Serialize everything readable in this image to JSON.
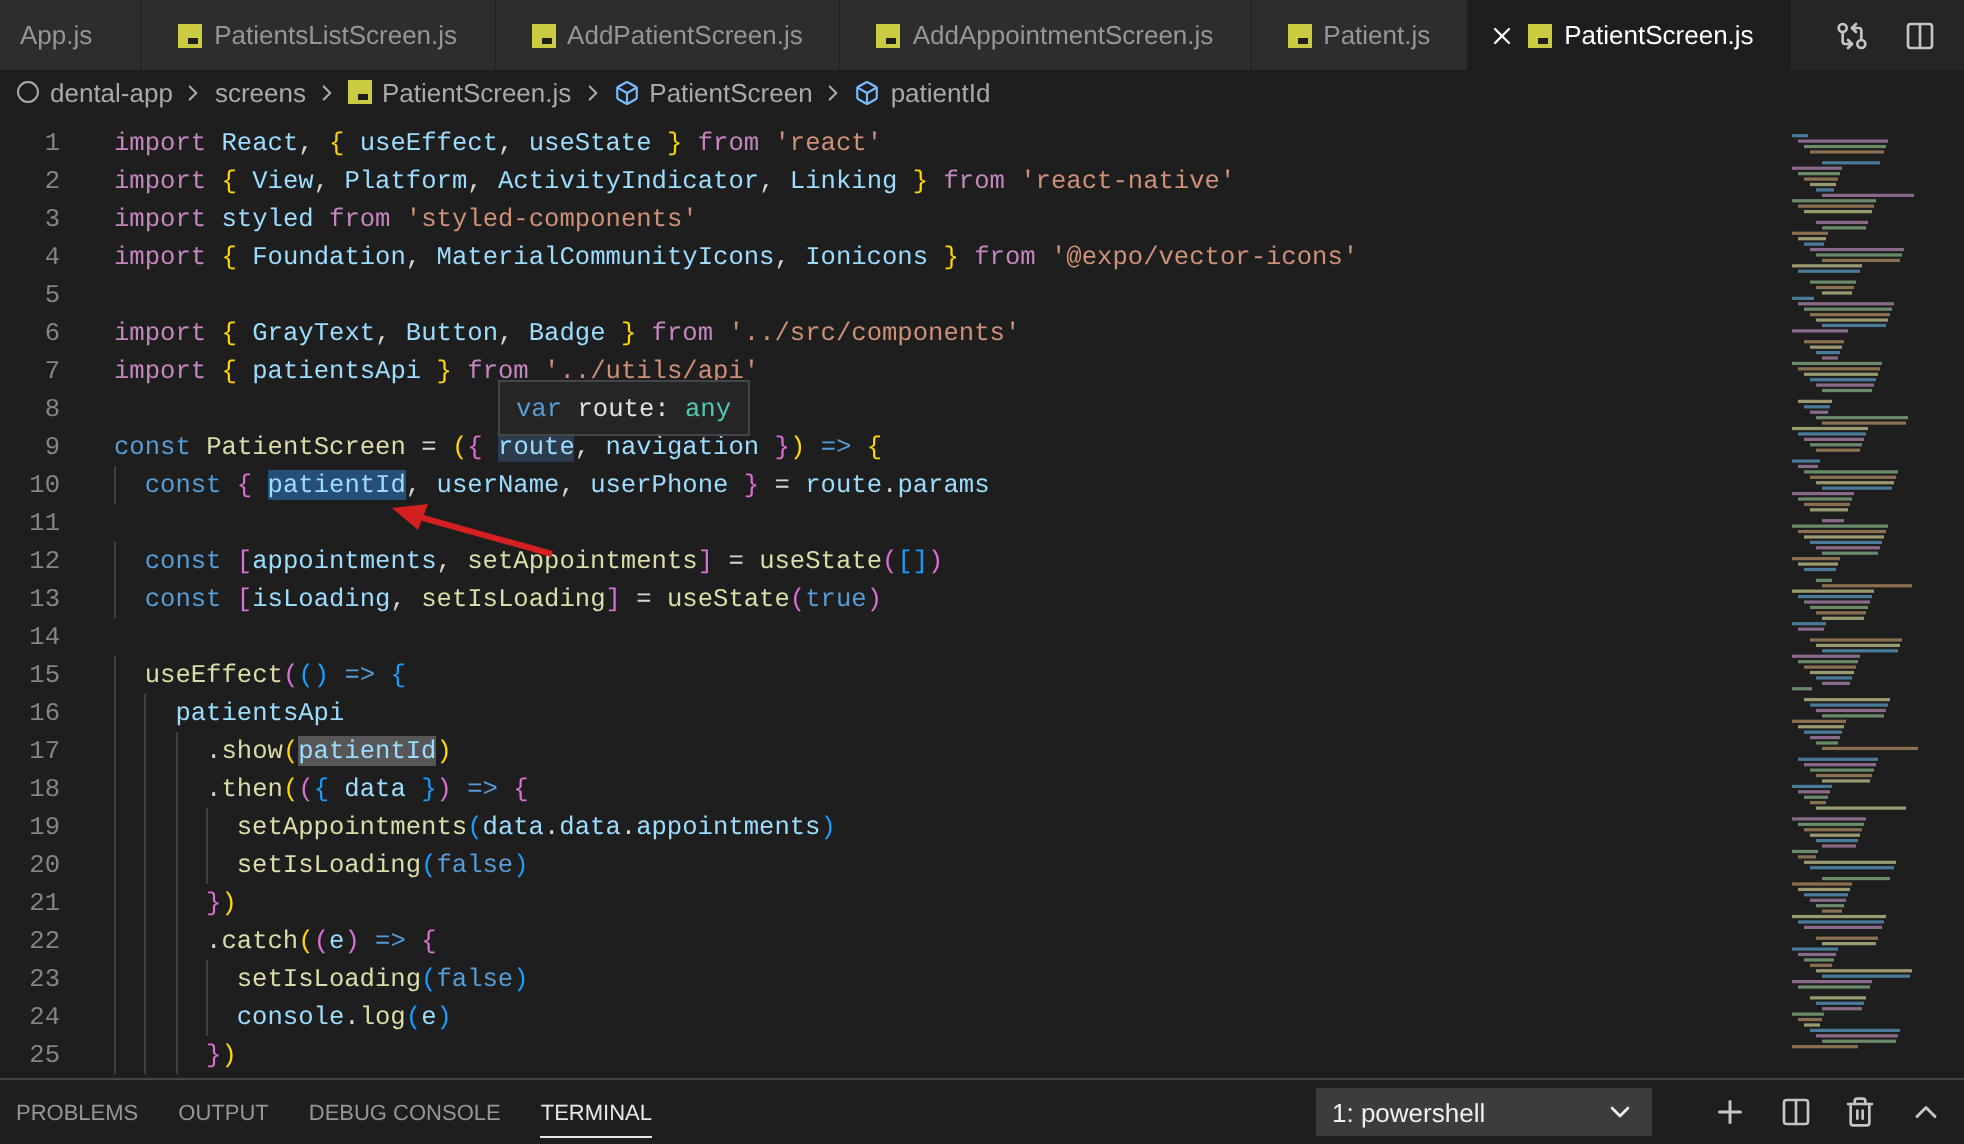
{
  "tabs": [
    {
      "label": "App.js",
      "selected": false,
      "file_icon": false
    },
    {
      "label": "PatientsListScreen.js",
      "selected": false,
      "file_icon": true
    },
    {
      "label": "AddPatientScreen.js",
      "selected": false,
      "file_icon": true
    },
    {
      "label": "AddAppointmentScreen.js",
      "selected": false,
      "file_icon": true
    },
    {
      "label": "Patient.js",
      "selected": false,
      "file_icon": true
    },
    {
      "label": "PatientScreen.js",
      "selected": true,
      "file_icon": true
    }
  ],
  "breadcrumb": [
    {
      "label": "dental-app",
      "kind": "folder"
    },
    {
      "label": "screens",
      "kind": "plain"
    },
    {
      "label": "PatientScreen.js",
      "kind": "file"
    },
    {
      "label": "PatientScreen",
      "kind": "symbol"
    },
    {
      "label": "patientId",
      "kind": "symbol"
    }
  ],
  "editor": {
    "lines": [
      {
        "number": "1",
        "tokens": [
          {
            "text": "import",
            "kind": "keyword"
          },
          {
            "text": " React",
            "kind": "variable"
          },
          {
            "text": ", ",
            "kind": "plain"
          },
          {
            "text": "{",
            "kind": "bracket1"
          },
          {
            "text": " useEffect",
            "kind": "variable"
          },
          {
            "text": ", ",
            "kind": "plain"
          },
          {
            "text": "useState ",
            "kind": "variable"
          },
          {
            "text": "}",
            "kind": "bracket1"
          },
          {
            "text": " from",
            "kind": "keyword"
          },
          {
            "text": " 'react'",
            "kind": "string"
          }
        ]
      },
      {
        "number": "2",
        "tokens": [
          {
            "text": "import",
            "kind": "keyword"
          },
          {
            "text": " {",
            "kind": "bracket1"
          },
          {
            "text": " View",
            "kind": "variable"
          },
          {
            "text": ", ",
            "kind": "plain"
          },
          {
            "text": "Platform",
            "kind": "variable"
          },
          {
            "text": ", ",
            "kind": "plain"
          },
          {
            "text": "ActivityIndicator",
            "kind": "variable"
          },
          {
            "text": ", ",
            "kind": "plain"
          },
          {
            "text": "Linking ",
            "kind": "variable"
          },
          {
            "text": "}",
            "kind": "bracket1"
          },
          {
            "text": " from",
            "kind": "keyword"
          },
          {
            "text": " 'react-native'",
            "kind": "string"
          }
        ]
      },
      {
        "number": "3",
        "tokens": [
          {
            "text": "import",
            "kind": "keyword"
          },
          {
            "text": " styled",
            "kind": "variable"
          },
          {
            "text": " from",
            "kind": "keyword"
          },
          {
            "text": " 'styled-components'",
            "kind": "string"
          }
        ]
      },
      {
        "number": "4",
        "tokens": [
          {
            "text": "import",
            "kind": "keyword"
          },
          {
            "text": " {",
            "kind": "bracket1"
          },
          {
            "text": " Foundation",
            "kind": "variable"
          },
          {
            "text": ", ",
            "kind": "plain"
          },
          {
            "text": "MaterialCommunityIcons",
            "kind": "variable"
          },
          {
            "text": ", ",
            "kind": "plain"
          },
          {
            "text": "Ionicons ",
            "kind": "variable"
          },
          {
            "text": "}",
            "kind": "bracket1"
          },
          {
            "text": " from",
            "kind": "keyword"
          },
          {
            "text": " '@expo/vector-icons'",
            "kind": "string"
          }
        ]
      },
      {
        "number": "5"
      },
      {
        "number": "6",
        "tokens": [
          {
            "text": "import",
            "kind": "keyword"
          },
          {
            "text": " {",
            "kind": "bracket1"
          },
          {
            "text": " GrayText",
            "kind": "variable"
          },
          {
            "text": ", ",
            "kind": "plain"
          },
          {
            "text": "Button",
            "kind": "variable"
          },
          {
            "text": ", ",
            "kind": "plain"
          },
          {
            "text": "Badge ",
            "kind": "variable"
          },
          {
            "text": "}",
            "kind": "bracket1"
          },
          {
            "text": " from",
            "kind": "keyword"
          },
          {
            "text": " '../src/components'",
            "kind": "string"
          }
        ]
      },
      {
        "number": "7",
        "tokens": [
          {
            "text": "import",
            "kind": "keyword"
          },
          {
            "text": " {",
            "kind": "bracket1"
          },
          {
            "text": " patientsApi ",
            "kind": "variable"
          },
          {
            "text": "}",
            "kind": "bracket1"
          },
          {
            "text": " from",
            "kind": "keyword"
          },
          {
            "text": " '../utils/api'",
            "kind": "string"
          }
        ]
      },
      {
        "number": "8"
      },
      {
        "number": "9",
        "tokens": [
          {
            "text": "const",
            "kind": "storage"
          },
          {
            "text": " PatientScreen",
            "kind": "function"
          },
          {
            "text": " = ",
            "kind": "plain"
          },
          {
            "text": "(",
            "kind": "bracket1"
          },
          {
            "text": "{ ",
            "kind": "bracket2"
          },
          {
            "text": "route",
            "kind": "variable",
            "hovered": true
          },
          {
            "text": ", ",
            "kind": "plain"
          },
          {
            "text": "navigation ",
            "kind": "variable"
          },
          {
            "text": "}",
            "kind": "bracket2"
          },
          {
            "text": ")",
            "kind": "bracket1"
          },
          {
            "text": " => ",
            "kind": "storage"
          },
          {
            "text": "{",
            "kind": "bracket1"
          }
        ]
      },
      {
        "number": "10",
        "tokens": [
          {
            "text": "  const",
            "kind": "storage"
          },
          {
            "text": " { ",
            "kind": "bracket2"
          },
          {
            "text": "patientId",
            "kind": "variable",
            "selected": true
          },
          {
            "text": ", ",
            "kind": "plain"
          },
          {
            "text": "userName",
            "kind": "variable"
          },
          {
            "text": ", ",
            "kind": "plain"
          },
          {
            "text": "userPhone ",
            "kind": "variable"
          },
          {
            "text": "}",
            "kind": "bracket2"
          },
          {
            "text": " = ",
            "kind": "plain"
          },
          {
            "text": "route",
            "kind": "variable"
          },
          {
            "text": ".",
            "kind": "plain"
          },
          {
            "text": "params",
            "kind": "variable"
          }
        ]
      },
      {
        "number": "11"
      },
      {
        "number": "12",
        "tokens": [
          {
            "text": "  const",
            "kind": "storage"
          },
          {
            "text": " [",
            "kind": "bracket2"
          },
          {
            "text": "appointments",
            "kind": "variable"
          },
          {
            "text": ", ",
            "kind": "plain"
          },
          {
            "text": "setAppointments",
            "kind": "function"
          },
          {
            "text": "]",
            "kind": "bracket2"
          },
          {
            "text": " = ",
            "kind": "plain"
          },
          {
            "text": "useState",
            "kind": "function"
          },
          {
            "text": "(",
            "kind": "bracket2"
          },
          {
            "text": "[]",
            "kind": "bracket3"
          },
          {
            "text": ")",
            "kind": "bracket2"
          }
        ]
      },
      {
        "number": "13",
        "tokens": [
          {
            "text": "  const",
            "kind": "storage"
          },
          {
            "text": " [",
            "kind": "bracket2"
          },
          {
            "text": "isLoading",
            "kind": "variable"
          },
          {
            "text": ", ",
            "kind": "plain"
          },
          {
            "text": "setIsLoading",
            "kind": "function"
          },
          {
            "text": "]",
            "kind": "bracket2"
          },
          {
            "text": " = ",
            "kind": "plain"
          },
          {
            "text": "useState",
            "kind": "function"
          },
          {
            "text": "(",
            "kind": "bracket2"
          },
          {
            "text": "true",
            "kind": "storage"
          },
          {
            "text": ")",
            "kind": "bracket2"
          }
        ]
      },
      {
        "number": "14"
      },
      {
        "number": "15",
        "tokens": [
          {
            "text": "  useEffect",
            "kind": "function"
          },
          {
            "text": "(",
            "kind": "bracket2"
          },
          {
            "text": "()",
            "kind": "bracket3"
          },
          {
            "text": " => ",
            "kind": "storage"
          },
          {
            "text": "{",
            "kind": "bracket3"
          }
        ]
      },
      {
        "number": "16",
        "tokens": [
          {
            "text": "    patientsApi",
            "kind": "variable"
          }
        ]
      },
      {
        "number": "17",
        "tokens": [
          {
            "text": "      .",
            "kind": "plain"
          },
          {
            "text": "show",
            "kind": "function"
          },
          {
            "text": "(",
            "kind": "bracket1"
          },
          {
            "text": "patientId",
            "kind": "variable",
            "highlighted": true
          },
          {
            "text": ")",
            "kind": "bracket1"
          }
        ]
      },
      {
        "number": "18",
        "tokens": [
          {
            "text": "      .",
            "kind": "plain"
          },
          {
            "text": "then",
            "kind": "function"
          },
          {
            "text": "(",
            "kind": "bracket1"
          },
          {
            "text": "(",
            "kind": "bracket2"
          },
          {
            "text": "{",
            "kind": "bracket3"
          },
          {
            "text": " data ",
            "kind": "variable"
          },
          {
            "text": "}",
            "kind": "bracket3"
          },
          {
            "text": ")",
            "kind": "bracket2"
          },
          {
            "text": " => ",
            "kind": "storage"
          },
          {
            "text": "{",
            "kind": "bracket2"
          }
        ]
      },
      {
        "number": "19",
        "tokens": [
          {
            "text": "        setAppointments",
            "kind": "function"
          },
          {
            "text": "(",
            "kind": "bracket3"
          },
          {
            "text": "data",
            "kind": "variable"
          },
          {
            "text": ".",
            "kind": "plain"
          },
          {
            "text": "data",
            "kind": "variable"
          },
          {
            "text": ".",
            "kind": "plain"
          },
          {
            "text": "appointments",
            "kind": "variable"
          },
          {
            "text": ")",
            "kind": "bracket3"
          }
        ]
      },
      {
        "number": "20",
        "tokens": [
          {
            "text": "        setIsLoading",
            "kind": "function"
          },
          {
            "text": "(",
            "kind": "bracket3"
          },
          {
            "text": "false",
            "kind": "storage"
          },
          {
            "text": ")",
            "kind": "bracket3"
          }
        ]
      },
      {
        "number": "21",
        "tokens": [
          {
            "text": "      }",
            "kind": "bracket2"
          },
          {
            "text": ")",
            "kind": "bracket1"
          }
        ]
      },
      {
        "number": "22",
        "tokens": [
          {
            "text": "      .",
            "kind": "plain"
          },
          {
            "text": "catch",
            "kind": "function"
          },
          {
            "text": "(",
            "kind": "bracket1"
          },
          {
            "text": "(",
            "kind": "bracket2"
          },
          {
            "text": "e",
            "kind": "variable"
          },
          {
            "text": ")",
            "kind": "bracket2"
          },
          {
            "text": " => ",
            "kind": "storage"
          },
          {
            "text": "{",
            "kind": "bracket2"
          }
        ]
      },
      {
        "number": "23",
        "tokens": [
          {
            "text": "        setIsLoading",
            "kind": "function"
          },
          {
            "text": "(",
            "kind": "bracket3"
          },
          {
            "text": "false",
            "kind": "storage"
          },
          {
            "text": ")",
            "kind": "bracket3"
          }
        ]
      },
      {
        "number": "24",
        "tokens": [
          {
            "text": "        console",
            "kind": "variable"
          },
          {
            "text": ".",
            "kind": "plain"
          },
          {
            "text": "log",
            "kind": "function"
          },
          {
            "text": "(",
            "kind": "bracket3"
          },
          {
            "text": "e",
            "kind": "variable"
          },
          {
            "text": ")",
            "kind": "bracket3"
          }
        ]
      },
      {
        "number": "25",
        "tokens": [
          {
            "text": "      }",
            "kind": "bracket2"
          },
          {
            "text": ")",
            "kind": "bracket1"
          }
        ]
      }
    ],
    "hover": {
      "keyword": "var",
      "name": "route:",
      "type": "any"
    }
  },
  "panel": {
    "tabs": [
      {
        "label": "PROBLEMS",
        "selected": false
      },
      {
        "label": "OUTPUT",
        "selected": false
      },
      {
        "label": "DEBUG CONSOLE",
        "selected": false
      },
      {
        "label": "TERMINAL",
        "selected": true
      }
    ],
    "terminal_select": "1: powershell"
  }
}
